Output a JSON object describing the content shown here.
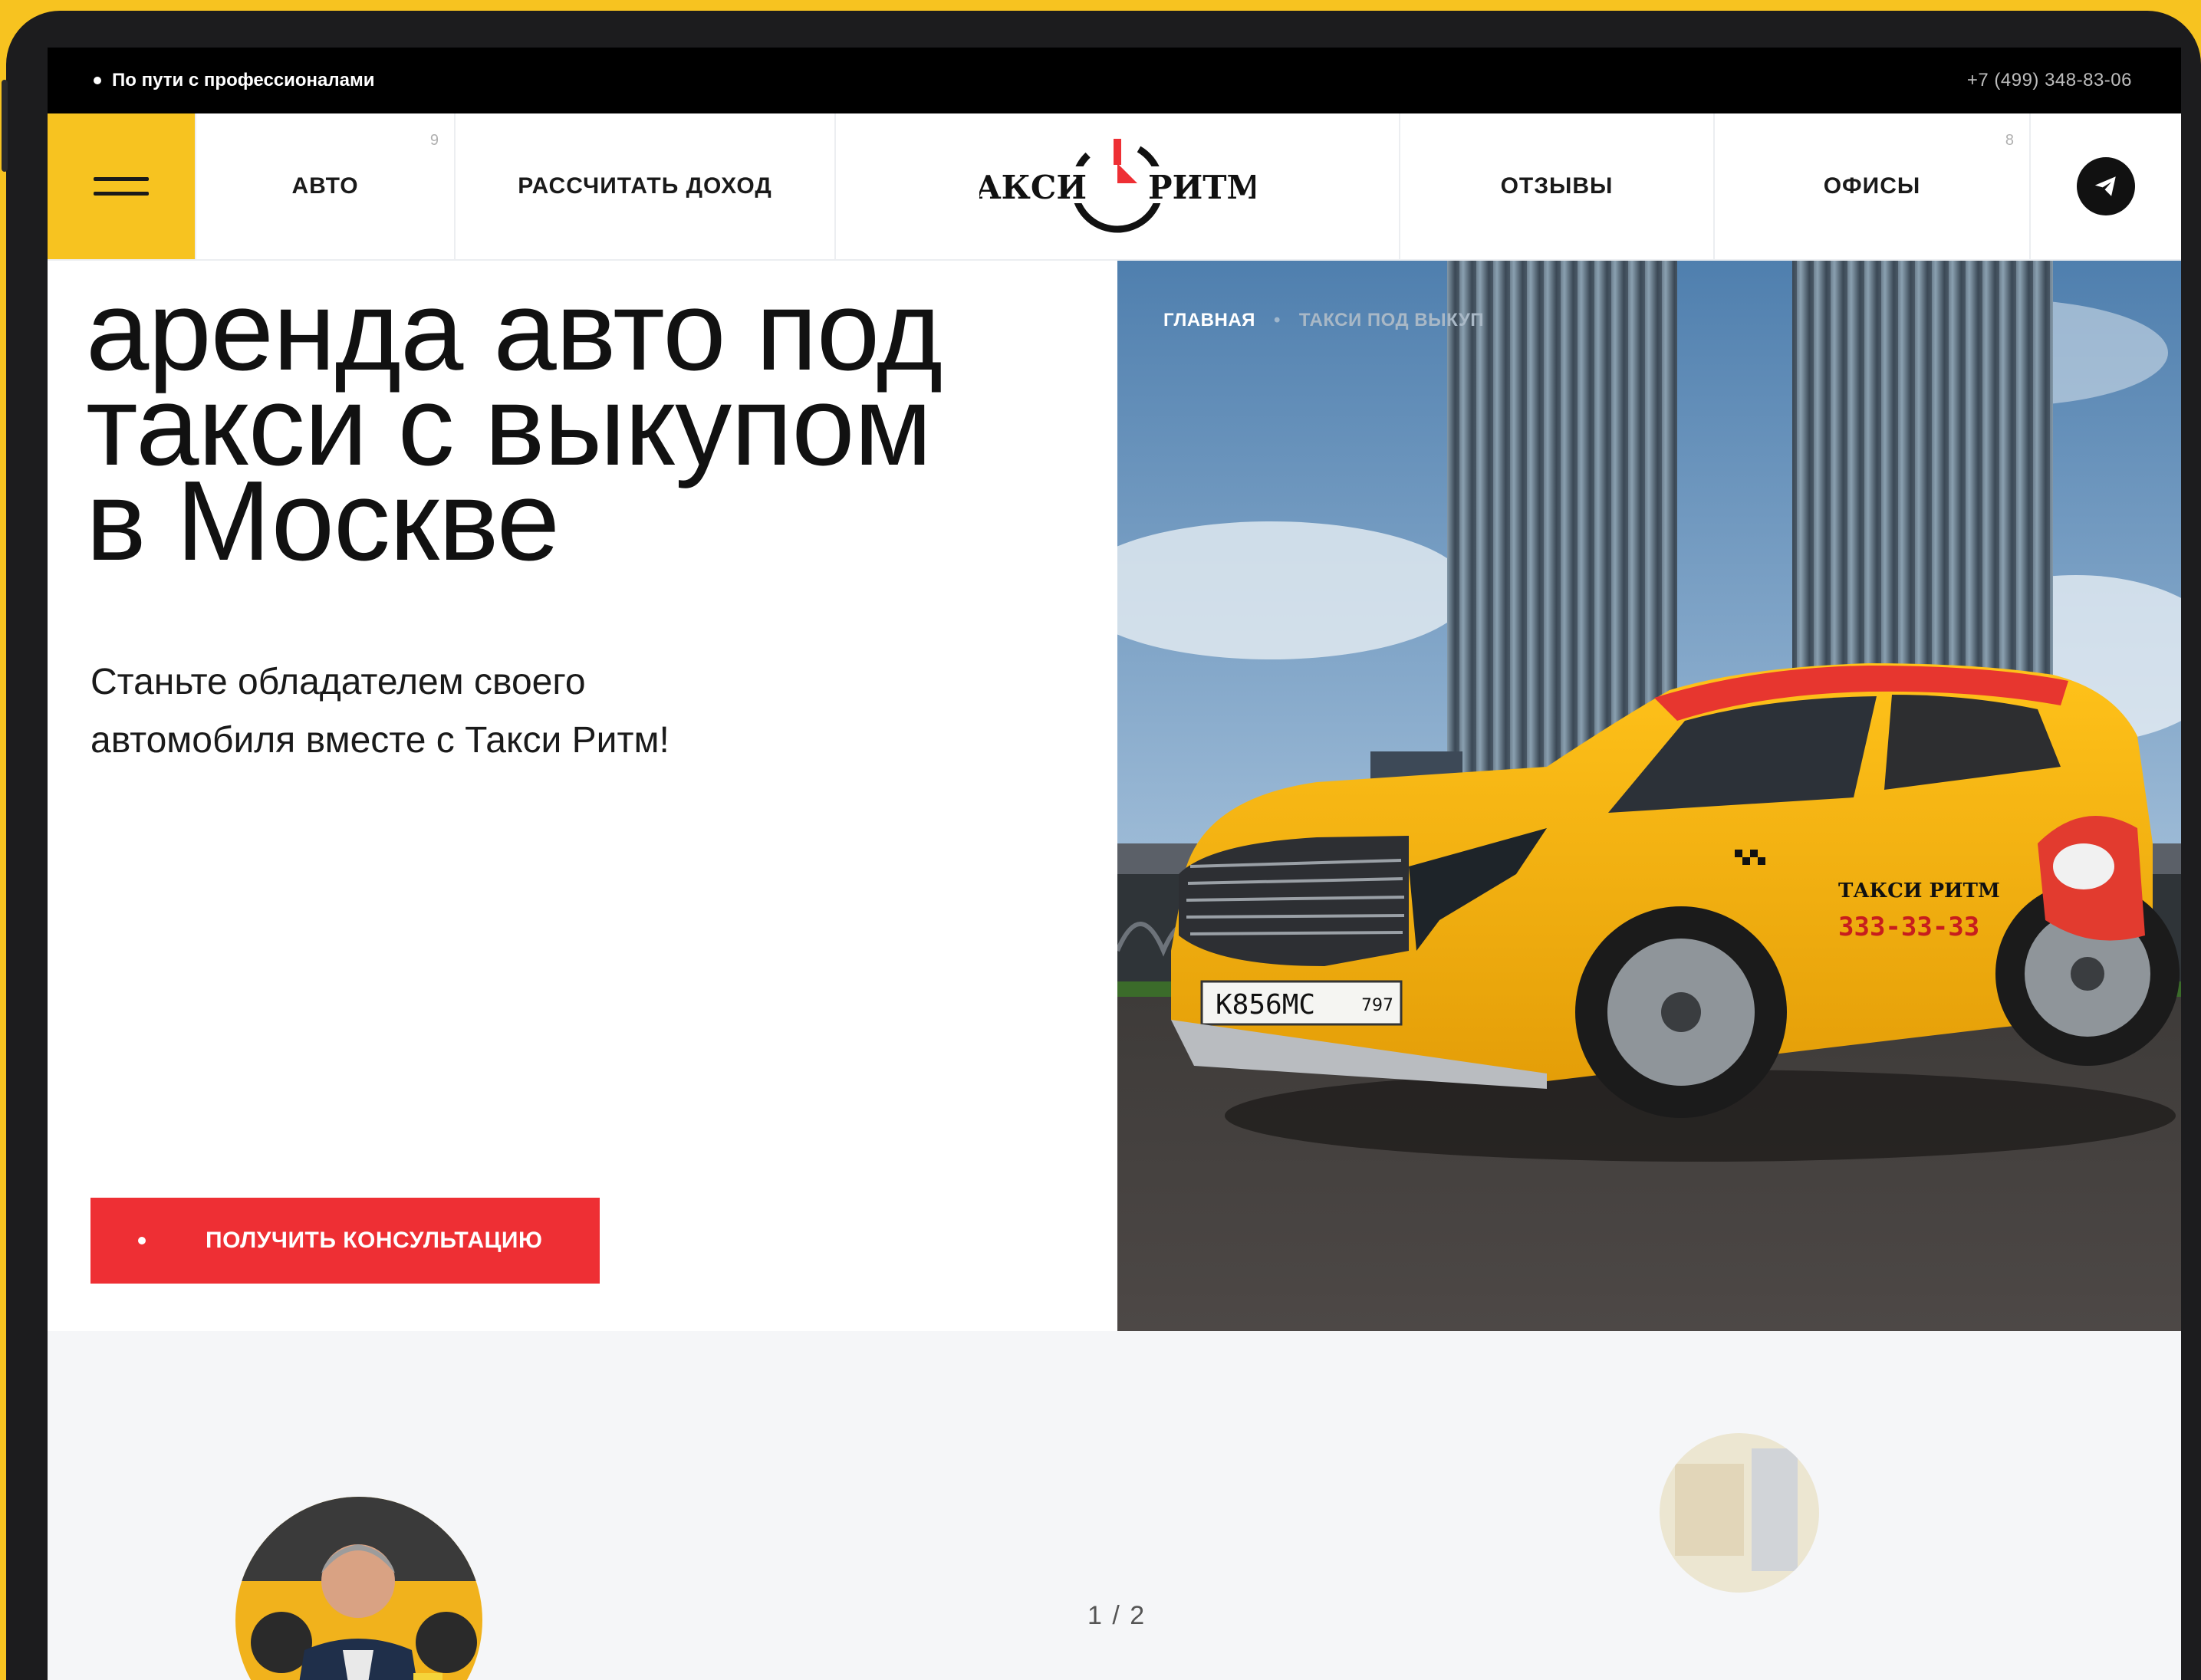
{
  "topbar": {
    "tagline": "По пути с профессионалами",
    "phone": "+7 (499) 348-83-06"
  },
  "nav": {
    "items": [
      {
        "label": "АВТО",
        "count": "9"
      },
      {
        "label": "РАССЧИТАТЬ ДОХОД"
      },
      {
        "label": "ОТЗЫВЫ"
      },
      {
        "label": "ОФИСЫ",
        "count": "8"
      }
    ],
    "logo_left": "ТАКСИ",
    "logo_right": "РИТМ"
  },
  "hero": {
    "title_lines": [
      "аренда авто под",
      "такси с выкупом",
      "в Москве"
    ],
    "subtitle_lines": [
      "Станьте обладателем своего",
      "автомобиля вместе с Такси Ритм!"
    ],
    "cta_label": "ПОЛУЧИТЬ КОНСУЛЬТАЦИЮ"
  },
  "breadcrumb": {
    "home": "ГЛАВНАЯ",
    "separator": "•",
    "current": "ТАКСИ ПОД ВЫКУП"
  },
  "car": {
    "plate_number": "К856МС",
    "plate_region": "797",
    "door_brand": "ТАКСИ РИТМ",
    "door_phone": "333-33-33"
  },
  "reviews": {
    "pager": "1 / 2"
  },
  "colors": {
    "brand_yellow": "#f7c320",
    "accent_red": "#ee2f34",
    "dark": "#111111"
  },
  "icons": {
    "menu": "hamburger-icon",
    "telegram": "telegram-plane-icon"
  }
}
